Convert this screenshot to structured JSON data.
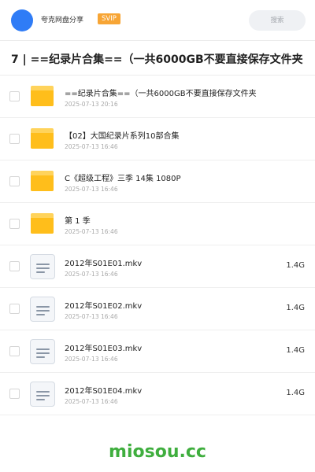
{
  "header": {
    "share_name": "夸克网盘分享",
    "badge": "SVIP",
    "search_label": "搜索"
  },
  "path_title": "7 | ==纪录片合集==（一共6000GB不要直接保存文件夹",
  "items": [
    {
      "type": "folder",
      "name": "==纪录片合集==（一共6000GB不要直接保存文件夹",
      "date": "2025-07-13 20:16",
      "size": ""
    },
    {
      "type": "folder",
      "name": "【02】大国纪录片系列10部合集",
      "date": "2025-07-13 16:46",
      "size": ""
    },
    {
      "type": "folder",
      "name": "C《超级工程》三季 14集 1080P",
      "date": "2025-07-13 16:46",
      "size": ""
    },
    {
      "type": "folder",
      "name": "第 1 季",
      "date": "2025-07-13 16:46",
      "size": ""
    },
    {
      "type": "file",
      "name": "2012年S01E01.mkv",
      "date": "2025-07-13 16:46",
      "size": "1.4G"
    },
    {
      "type": "file",
      "name": "2012年S01E02.mkv",
      "date": "2025-07-13 16:46",
      "size": "1.4G"
    },
    {
      "type": "file",
      "name": "2012年S01E03.mkv",
      "date": "2025-07-13 16:46",
      "size": "1.4G"
    },
    {
      "type": "file",
      "name": "2012年S01E04.mkv",
      "date": "2025-07-13 16:46",
      "size": "1.4G"
    }
  ],
  "watermark": "miosou.cc",
  "colors": {
    "avatar": "#2f7cf6",
    "badge": "#f7a535",
    "folder": "#ffbe1b",
    "watermark": "#3fae3e"
  },
  "icons": {
    "folder": "folder-icon",
    "file": "document-icon"
  }
}
